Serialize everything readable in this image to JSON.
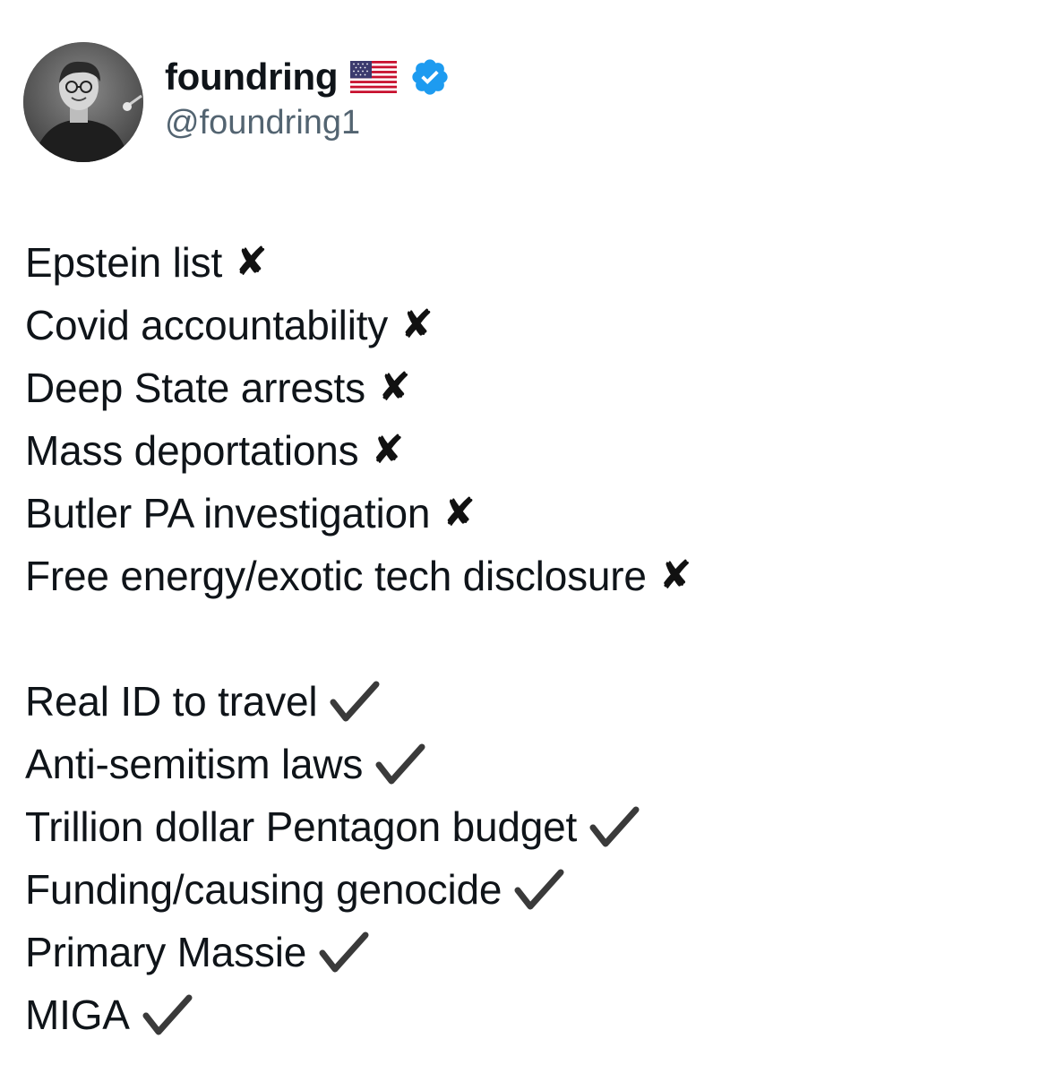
{
  "author": {
    "display_name": "foundring",
    "handle": "@foundring1",
    "flag_icon": "us-flag-icon",
    "verified_icon": "verified-badge-icon",
    "verified_color": "#1d9bf0"
  },
  "tweet": {
    "failed_items": [
      {
        "text": "Epstein list",
        "mark": "✘"
      },
      {
        "text": "Covid accountability",
        "mark": "✘"
      },
      {
        "text": "Deep State arrests",
        "mark": "✘"
      },
      {
        "text": "Mass deportations",
        "mark": "✘"
      },
      {
        "text": "Butler PA investigation",
        "mark": "✘"
      },
      {
        "text": "Free energy/exotic tech disclosure",
        "mark": "✘"
      }
    ],
    "done_items": [
      {
        "text": "Real ID to travel",
        "mark": "check-icon"
      },
      {
        "text": "Anti-semitism laws",
        "mark": "check-icon"
      },
      {
        "text": "Trillion dollar Pentagon budget",
        "mark": "check-icon"
      },
      {
        "text": "Funding/causing genocide",
        "mark": "check-icon"
      },
      {
        "text": "Primary Massie",
        "mark": "check-icon"
      },
      {
        "text": "MIGA",
        "mark": "check-icon"
      }
    ]
  }
}
